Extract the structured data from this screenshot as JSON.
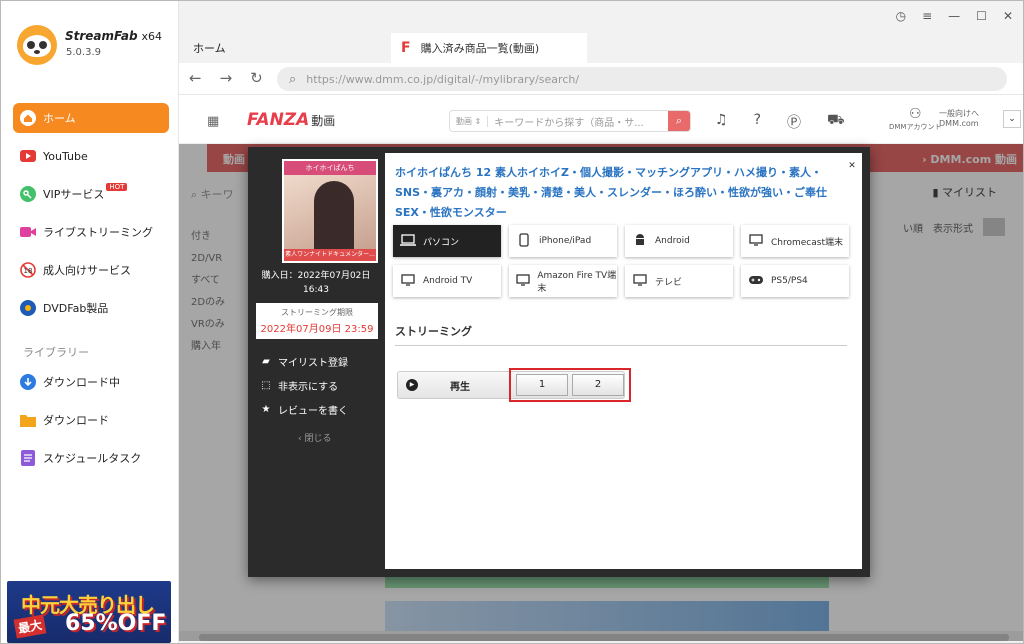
{
  "app": {
    "brand": "StreamFab",
    "arch": "x64",
    "version": "5.0.3.9"
  },
  "sidebar": {
    "items": [
      {
        "label": "ホーム",
        "icon": "home-icon"
      },
      {
        "label": "YouTube",
        "icon": "youtube-icon"
      },
      {
        "label": "VIPサービス",
        "icon": "key-icon",
        "badge": "HOT"
      },
      {
        "label": "ライブストリーミング",
        "icon": "live-camera-icon"
      },
      {
        "label": "成人向けサービス",
        "icon": "adult-restricted-icon"
      },
      {
        "label": "DVDFab製品",
        "icon": "dvdfab-icon"
      }
    ],
    "library_label": "ライブラリー",
    "library": [
      {
        "label": "ダウンロード中",
        "icon": "download-arrow-icon"
      },
      {
        "label": "ダウンロード",
        "icon": "folder-icon"
      },
      {
        "label": "スケジュールタスク",
        "icon": "schedule-list-icon"
      }
    ],
    "promo": {
      "line1": "中元大売り出し",
      "line2": "最大",
      "line3": "65%OFF"
    }
  },
  "tabs": {
    "home": "ホーム",
    "active_icon": "F",
    "active": "購入済み商品一覧(動画)"
  },
  "address": {
    "url": "https://www.dmm.co.jp/digital/-/mylibrary/search/"
  },
  "fanza": {
    "logo": "FANZA",
    "logo_sub": "動画",
    "search_category": "動画 ⇕",
    "search_placeholder": "キーワードから探す（商品・サ...",
    "account_label": "DMMアカウント",
    "account_line1": "一般向けへ",
    "account_line2": "DMM.com",
    "nav_left": "動画トップ",
    "nav_right": "› DMM.com 動画"
  },
  "background": {
    "search": "キーワ",
    "mylist": "マイリスト",
    "sort_label": "い順",
    "view_label": "表示形式",
    "filters": [
      "付き",
      "2D/VR",
      "すべて",
      "2Dのみ",
      "VRのみ",
      "購入年"
    ]
  },
  "modal": {
    "cover_top": "ホイホイぱんち",
    "cover_bottom": "素人ワンナイトドキュメンター...",
    "purchase_line1": "購入日：2022年07月02日",
    "purchase_line2": "16:43",
    "stream_limit_label": "ストリーミング期限",
    "stream_limit_date": "2022年07月09日 23:59",
    "actions": [
      {
        "label": "マイリスト登録",
        "icon": "folder-add-icon"
      },
      {
        "label": "非表示にする",
        "icon": "hide-dashed-icon"
      },
      {
        "label": "レビューを書く",
        "icon": "star-icon"
      }
    ],
    "close_label": "‹ 閉じる",
    "title": "ホイホイぱんち 12 素人ホイホイZ・個人撮影・マッチングアプリ・ハメ撮り・素人・SNS・裏アカ・顔射・美乳・清楚・美人・スレンダー・ほろ酔い・性欲が強い・ご奉仕SEX・性欲モンスター",
    "devices": [
      {
        "label": "パソコン",
        "icon": "laptop-icon",
        "active": true
      },
      {
        "label": "iPhone/iPad",
        "icon": "phone-icon",
        "active": false
      },
      {
        "label": "Android",
        "icon": "android-icon",
        "active": false
      },
      {
        "label": "Chromecast端末",
        "icon": "monitor-icon",
        "active": false
      },
      {
        "label": "Android TV",
        "icon": "monitor-icon",
        "active": false
      },
      {
        "label": "Amazon Fire TV端末",
        "icon": "monitor-icon",
        "active": false
      },
      {
        "label": "テレビ",
        "icon": "monitor-icon",
        "active": false
      },
      {
        "label": "PS5/PS4",
        "icon": "gamepad-icon",
        "active": false
      }
    ],
    "streaming_heading": "ストリーミング",
    "play_label": "再生",
    "parts": [
      "1",
      "2"
    ]
  }
}
